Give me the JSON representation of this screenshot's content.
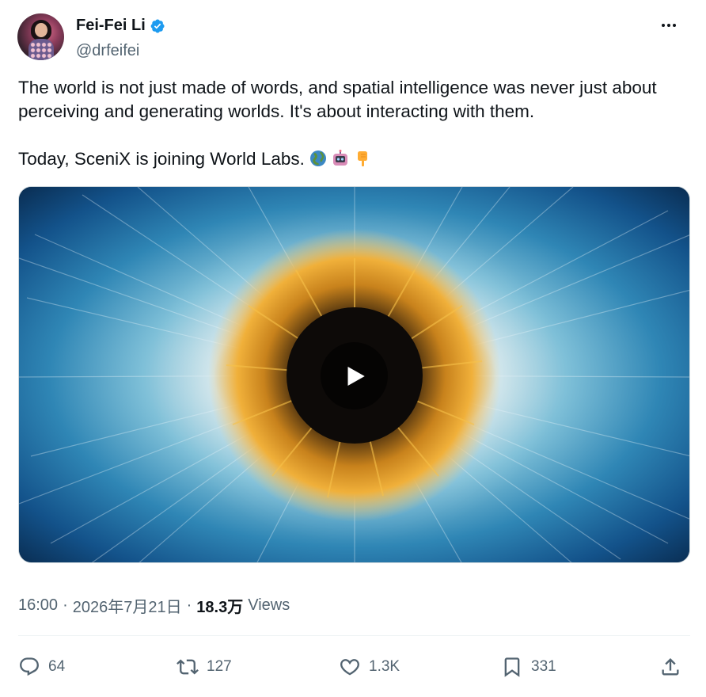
{
  "author": {
    "name": "Fei-Fei Li",
    "handle": "@drfeifei",
    "verified_icon": "verified-badge-icon",
    "verified_color": "#1d9bf0"
  },
  "tweet": {
    "line1": "The world is not just made of words, and spatial intelligence was never just about perceiving and generating worlds. It's about interacting with them.",
    "line2": "Today, SceniX is joining World Labs.",
    "emojis": [
      "globe-emoji",
      "robot-emoji",
      "pointing-down-emoji"
    ]
  },
  "media": {
    "type": "video",
    "description_icon": "play-icon"
  },
  "meta": {
    "time": "16:00",
    "date": "2026年7月21日",
    "views_count": "18.3万",
    "views_label": "Views",
    "separator": "·"
  },
  "actions": {
    "replies": "64",
    "reposts": "127",
    "likes": "1.3K",
    "bookmarks": "331"
  },
  "colors": {
    "text": "#0f1419",
    "secondary": "#536471",
    "divider": "#eff3f4"
  }
}
